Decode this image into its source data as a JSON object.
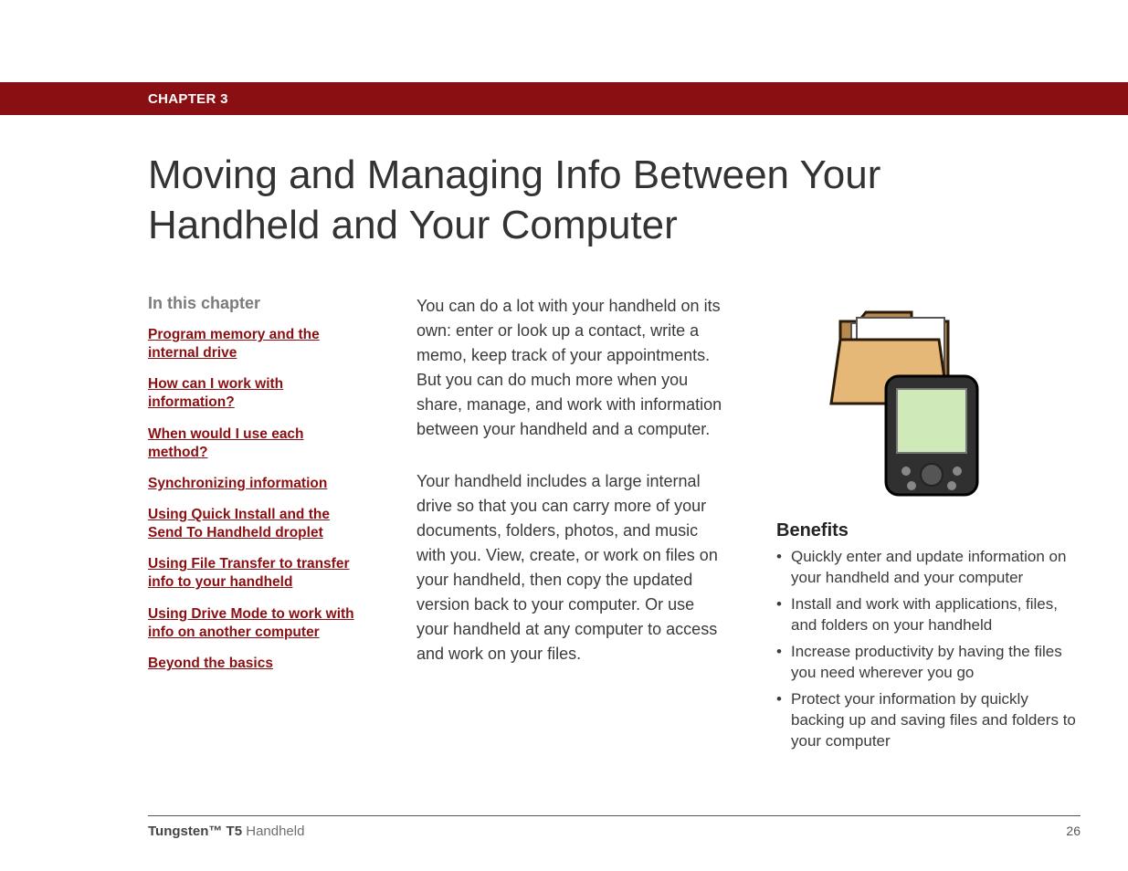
{
  "header": {
    "chapter_label": "CHAPTER 3",
    "title": "Moving and Managing Info Between Your Handheld and Your Computer"
  },
  "toc": {
    "heading": "In this chapter",
    "items": [
      "Program memory and the internal drive",
      "How can I work with information?",
      "When would I use each method?",
      "Synchronizing information",
      "Using Quick Install and the Send To Handheld droplet",
      "Using File Transfer to transfer info to your handheld",
      "Using Drive Mode to work with info on another computer",
      "Beyond the basics"
    ]
  },
  "body": {
    "p1": "You can do a lot with your handheld on its own: enter or look up a contact, write a memo, keep track of your appointments. But you can do much more when you share, manage, and work with information between your handheld and a computer.",
    "p2": "Your handheld includes a large internal drive so that you can carry more of your documents, folders, photos, and music with you. View, create, or work on files on your handheld, then copy the updated version back to your computer. Or use your handheld at any computer to access and work on your files."
  },
  "benefits": {
    "heading": "Benefits",
    "items": [
      "Quickly enter and update information on your handheld and your computer",
      "Install and work with applications, files, and folders on your handheld",
      "Increase productivity by having the files you need wherever you go",
      "Protect your information by quickly backing up and saving files and folders to your computer"
    ]
  },
  "footer": {
    "product_bold": "Tungsten™ T5",
    "product_rest": " Handheld",
    "page_number": "26"
  },
  "image": {
    "alt": "handheld-and-folder-icon"
  }
}
